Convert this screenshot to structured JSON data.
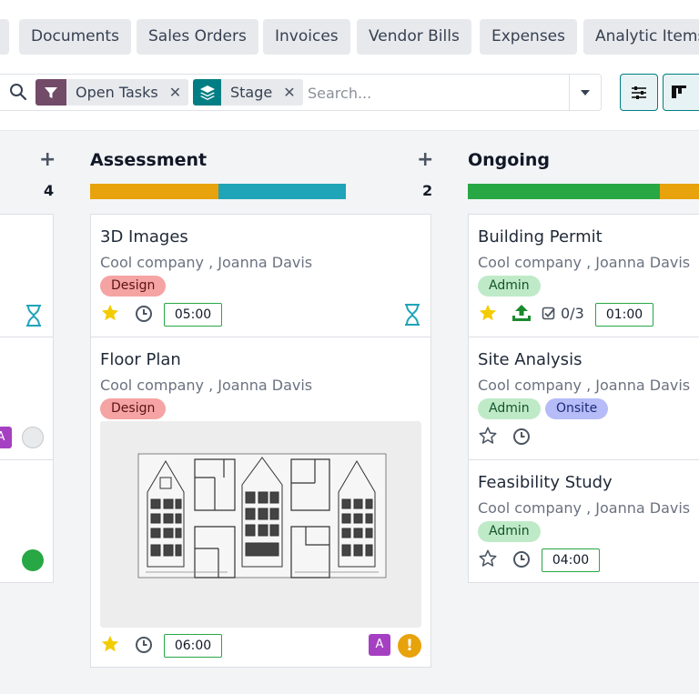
{
  "nav_buttons": [
    {
      "label": "Documents"
    },
    {
      "label": "Sales Orders"
    },
    {
      "label": "Invoices"
    },
    {
      "label": "Vendor Bills"
    },
    {
      "label": "Expenses"
    },
    {
      "label": "Analytic Items"
    }
  ],
  "search": {
    "placeholder": "Search...",
    "facets": [
      {
        "icon": "filter-icon",
        "label": "Open Tasks",
        "color": "#714b67"
      },
      {
        "icon": "layers-icon",
        "label": "Stage",
        "color": "#017e84"
      }
    ]
  },
  "columns": [
    {
      "title": "",
      "count": "4",
      "cards": [
        {
          "avatar": "A",
          "state": "grey"
        },
        {
          "state": "green"
        }
      ]
    },
    {
      "title": "Assessment",
      "count": "2",
      "progress": [
        {
          "color": "#e8a20c",
          "fraction": 0.5
        },
        {
          "color": "#1fa4b8",
          "fraction": 0.5
        }
      ],
      "cards": [
        {
          "title": "3D Images",
          "subtitle": "Cool company , Joanna Davis",
          "tag": "Design",
          "starred": true,
          "time": "05:00"
        },
        {
          "title": "Floor Plan",
          "subtitle": "Cool company , Joanna Davis",
          "tag": "Design",
          "starred": true,
          "time": "06:00",
          "avatar": "A",
          "priority": "!"
        }
      ]
    },
    {
      "title": "Ongoing",
      "progress": [
        {
          "color": "#28a745",
          "fraction": 0.83
        },
        {
          "color": "#e8a20c",
          "fraction": 0.17
        }
      ],
      "cards": [
        {
          "title": "Building Permit",
          "subtitle": "Cool company , Joanna Davis",
          "tags": [
            "Admin"
          ],
          "starred": true,
          "subtasks": "0/3",
          "time": "01:00"
        },
        {
          "title": "Site Analysis",
          "subtitle": "Cool company , Joanna Davis",
          "tags": [
            "Admin",
            "Onsite"
          ],
          "starred": false
        },
        {
          "title": "Feasibility Study",
          "subtitle": "Cool company , Joanna Davis",
          "tags": [
            "Admin"
          ],
          "starred": false,
          "time": "04:00"
        }
      ]
    }
  ],
  "colors": {
    "accent": "#017e84",
    "star": "#f3cc00",
    "hourglass": "#1fa4b8"
  }
}
